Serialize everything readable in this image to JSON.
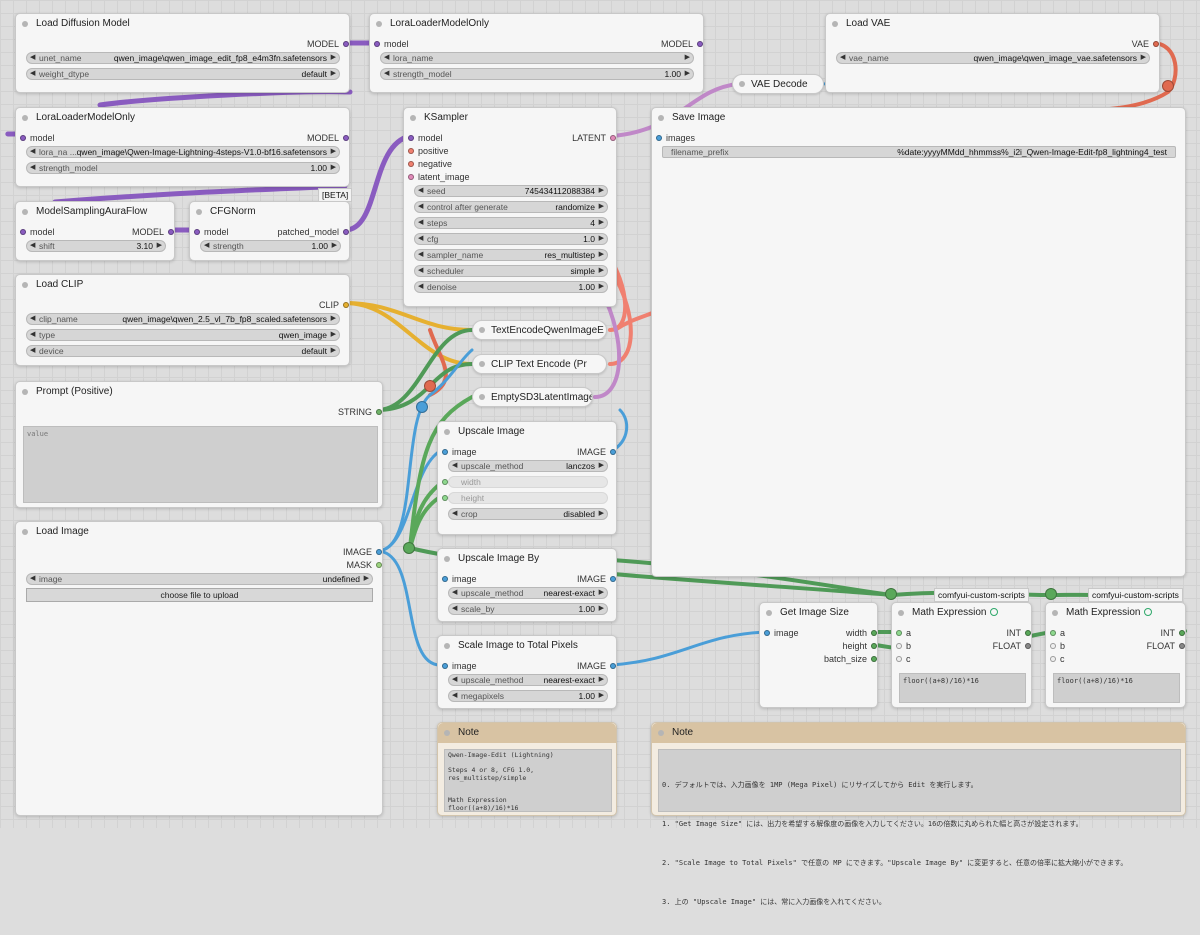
{
  "nodes": {
    "load_diffusion": {
      "title": "Load Diffusion Model",
      "out": "MODEL",
      "unet_label": "unet_name",
      "unet_value": "qwen_image\\qwen_image_edit_fp8_e4m3fn.safetensors",
      "dtype_label": "weight_dtype",
      "dtype_value": "default"
    },
    "lora1": {
      "title": "LoraLoaderModelOnly",
      "in": "model",
      "out": "MODEL",
      "lora_label": "lora_name",
      "lora_value": "",
      "strength_label": "strength_model",
      "strength_value": "1.00"
    },
    "load_vae": {
      "title": "Load VAE",
      "out": "VAE",
      "vae_label": "vae_name",
      "vae_value": "qwen_image\\qwen_image_vae.safetensors"
    },
    "vae_decode": {
      "title": "VAE Decode"
    },
    "lora2": {
      "title": "LoraLoaderModelOnly",
      "in": "model",
      "out": "MODEL",
      "lora_label": "lora_na ...",
      "lora_value": "qwen_image\\Qwen-Image-Lightning-4steps-V1.0-bf16.safetensors",
      "strength_label": "strength_model",
      "strength_value": "1.00"
    },
    "ksampler": {
      "title": "KSampler",
      "in_model": "model",
      "in_positive": "positive",
      "in_negative": "negative",
      "in_latent": "latent_image",
      "out": "LATENT",
      "widgets": [
        {
          "label": "seed",
          "value": "745434112088384"
        },
        {
          "label": "control after generate",
          "value": "randomize"
        },
        {
          "label": "steps",
          "value": "4"
        },
        {
          "label": "cfg",
          "value": "1.0"
        },
        {
          "label": "sampler_name",
          "value": "res_multistep"
        },
        {
          "label": "scheduler",
          "value": "simple"
        },
        {
          "label": "denoise",
          "value": "1.00"
        }
      ]
    },
    "save_image": {
      "title": "Save Image",
      "in": "images",
      "prefix_label": "filename_prefix",
      "prefix_value": "%date:yyyyMMdd_hhmmss%_i2i_Qwen-Image-Edit-fp8_lightning4_test"
    },
    "msaf": {
      "title": "ModelSamplingAuraFlow",
      "in": "model",
      "out": "MODEL",
      "shift_label": "shift",
      "shift_value": "3.10"
    },
    "cfgnorm": {
      "title": "CFGNorm",
      "badge": "[BETA]",
      "in": "model",
      "out": "patched_model",
      "strength_label": "strength",
      "strength_value": "1.00"
    },
    "load_clip": {
      "title": "Load CLIP",
      "out": "CLIP",
      "clip_label": "clip_name",
      "clip_value": "qwen_image\\qwen_2.5_vl_7b_fp8_scaled.safetensors",
      "type_label": "type",
      "type_value": "qwen_image",
      "device_label": "device",
      "device_value": "default"
    },
    "te_qwen": {
      "title": "TextEncodeQwenImageE"
    },
    "clip_text": {
      "title": "CLIP Text Encode (Pr"
    },
    "empty_latent": {
      "title": "EmptySD3LatentImage"
    },
    "prompt": {
      "title": "Prompt (Positive)",
      "out": "STRING",
      "placeholder": "value"
    },
    "upscale": {
      "title": "Upscale Image",
      "in": "image",
      "out": "IMAGE",
      "method_label": "upscale_method",
      "method_value": "lanczos",
      "width_label": "width",
      "height_label": "height",
      "crop_label": "crop",
      "crop_value": "disabled"
    },
    "load_image": {
      "title": "Load Image",
      "out_image": "IMAGE",
      "out_mask": "MASK",
      "image_label": "image",
      "image_value": "undefined",
      "upload_label": "choose file to upload"
    },
    "upscale_by": {
      "title": "Upscale Image By",
      "in": "image",
      "out": "IMAGE",
      "method_label": "upscale_method",
      "method_value": "nearest-exact",
      "scale_label": "scale_by",
      "scale_value": "1.00"
    },
    "scale_total": {
      "title": "Scale Image to Total Pixels",
      "in": "image",
      "out": "IMAGE",
      "method_label": "upscale_method",
      "method_value": "nearest-exact",
      "mp_label": "megapixels",
      "mp_value": "1.00"
    },
    "get_size": {
      "title": "Get Image Size",
      "in": "image",
      "out_w": "width",
      "out_h": "height",
      "out_b": "batch_size"
    },
    "math1": {
      "tag": "comfyui-custom-scripts",
      "title": "Math Expression",
      "in_a": "a",
      "in_b": "b",
      "in_c": "c",
      "out_int": "INT",
      "out_float": "FLOAT",
      "expr": "floor((a+8)/16)*16"
    },
    "math2": {
      "tag": "comfyui-custom-scripts",
      "title": "Math Expression",
      "in_a": "a",
      "in_b": "b",
      "in_c": "c",
      "out_int": "INT",
      "out_float": "FLOAT",
      "expr": "floor((a+8)/16)*16"
    },
    "note1": {
      "title": "Note",
      "text": "Qwen-Image-Edit (Lightning)\n\nSteps 4 or 8, CFG 1.0, res_multistep/simple\n\n\nMath Expression\nfloor((a+8)/16)*16"
    },
    "note2": {
      "title": "Note",
      "lines": [
        "0. デフォルトでは、入力画像を 1MP (Mega Pixel) にリサイズしてから Edit を実行します。",
        "1. \"Get Image Size\" には、出力を希望する解像度の画像を入力してください。16の倍数に丸められた幅と高さが設定されます。",
        "2. \"Scale Image to Total Pixels\" で任意の MP にできます。\"Upscale Image By\" に変更すると、任意の倍率に拡大縮小ができます。",
        "3. 上の \"Upscale Image\" には、常に入力画像を入れてください。"
      ]
    }
  },
  "colors": {
    "model": "#8a5cc0",
    "clip": "#e6b030",
    "vae": "#e06a50",
    "image": "#4a9ed8",
    "latent": "#e08ab8",
    "string": "#6fb368",
    "conditioning": "#f08070",
    "int": "#5aa85a",
    "float": "#aaaaaa"
  }
}
